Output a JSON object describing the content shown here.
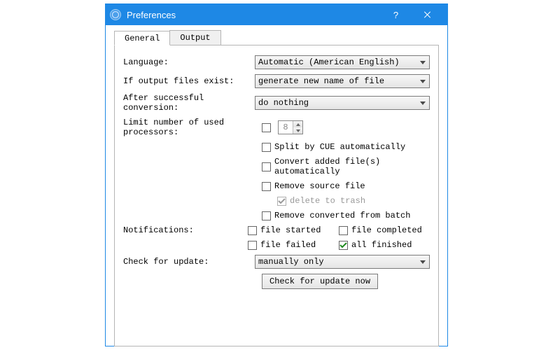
{
  "window": {
    "title": "Preferences"
  },
  "tabs": [
    {
      "label": "General",
      "active": true
    },
    {
      "label": "Output",
      "active": false
    }
  ],
  "labels": {
    "language": "Language:",
    "if_exist": "If output files exist:",
    "after_conv": "After successful conversion:",
    "limit_proc": "Limit number of used processors:",
    "notifications": "Notifications:",
    "update": "Check for update:"
  },
  "dropdowns": {
    "language": "Automatic (American English)",
    "if_exist": "generate new name of file",
    "after_conv": "do nothing",
    "update": "manually only"
  },
  "processors": {
    "enabled": false,
    "value": "8"
  },
  "options": {
    "split_cue": {
      "label": "Split by CUE automatically",
      "checked": false
    },
    "convert_added": {
      "label": "Convert added file(s) automatically",
      "checked": false
    },
    "remove_src": {
      "label": "Remove source file",
      "checked": false
    },
    "delete_trash": {
      "label": "delete to trash",
      "checked": true,
      "disabled": true
    },
    "remove_batch": {
      "label": "Remove converted from batch",
      "checked": false
    }
  },
  "notifications": {
    "file_started": {
      "label": "file started",
      "checked": false
    },
    "file_completed": {
      "label": "file completed",
      "checked": false
    },
    "file_failed": {
      "label": "file failed",
      "checked": false
    },
    "all_finished": {
      "label": "all finished",
      "checked": true
    }
  },
  "buttons": {
    "check_update": "Check for update now"
  }
}
